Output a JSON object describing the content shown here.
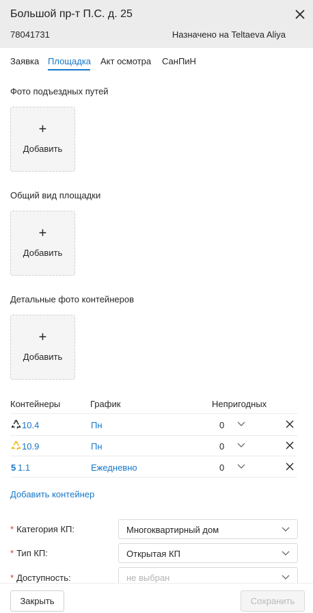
{
  "header": {
    "title": "Большой пр-т П.С. д. 25",
    "request_id": "78041731",
    "assigned": "Назначено на Teltaeva Aliya"
  },
  "tabs": [
    {
      "label": "Заявка",
      "active": false
    },
    {
      "label": "Площадка",
      "active": true
    },
    {
      "label": "Акт осмотра",
      "active": false
    },
    {
      "label": "СанПиН",
      "active": false
    }
  ],
  "sections": {
    "approach_photos": "Фото подъездных путей",
    "general_view": "Общий вид площадки",
    "container_photos": "Детальные фото контейнеров",
    "upload_plus": "+",
    "upload_label": "Добавить"
  },
  "containers": {
    "headers": {
      "containers": "Контейнеры",
      "schedule": "График",
      "unusable": "Непригодных"
    },
    "rows": [
      {
        "icon": "recycle-black-icon",
        "number": "10.4",
        "schedule": "Пн",
        "unusable": "0"
      },
      {
        "icon": "recycle-yellow-icon",
        "number": "10.9",
        "schedule": "Пн",
        "unusable": "0"
      },
      {
        "icon_text": "5",
        "number": "1.1",
        "schedule": "Ежедневно",
        "unusable": "0"
      }
    ],
    "add_label": "Добавить контейнер"
  },
  "form": {
    "category": {
      "label": "Категория КП:",
      "value": "Многоквартирный дом"
    },
    "type": {
      "label": "Тип КП:",
      "value": "Открытая КП"
    },
    "availability": {
      "label": "Доступность:",
      "placeholder": "не выбран"
    }
  },
  "footer": {
    "close": "Закрыть",
    "save": "Сохранить"
  },
  "colors": {
    "accent": "#1677c9",
    "required": "#e0312e",
    "header_bg": "#ececec",
    "recycle_yellow": "#f0b400"
  }
}
